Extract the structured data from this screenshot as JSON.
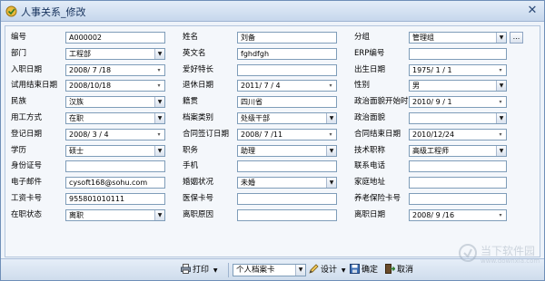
{
  "window": {
    "title": "人事关系_修改",
    "close": "✕"
  },
  "icons": {
    "title": "app-logo-icon",
    "dropdown": "▼",
    "date_picker": "▾",
    "ellipsis": "...",
    "print": "printer-icon",
    "design": "design-icon",
    "confirm": "confirm-icon",
    "cancel": "cancel-icon"
  },
  "fields": {
    "col1": [
      {
        "label": "编号",
        "value": "A000002",
        "type": "text"
      },
      {
        "label": "部门",
        "value": "工程部",
        "type": "combo"
      },
      {
        "label": "入职日期",
        "value": "2008/ 7 /18",
        "type": "date"
      },
      {
        "label": "试用结束日期",
        "value": "2008/10/18",
        "type": "date"
      },
      {
        "label": "民族",
        "value": "汉族",
        "type": "combo"
      },
      {
        "label": "用工方式",
        "value": "在职",
        "type": "combo"
      },
      {
        "label": "登记日期",
        "value": "2008/ 3 / 4",
        "type": "date"
      },
      {
        "label": "学历",
        "value": "硕士",
        "type": "combo"
      },
      {
        "label": "身份证号",
        "value": "",
        "type": "text"
      },
      {
        "label": "电子邮件",
        "value": "cysoft168@sohu.com",
        "type": "text"
      },
      {
        "label": "工资卡号",
        "value": "955801010111",
        "type": "text"
      },
      {
        "label": "在职状态",
        "value": "离职",
        "type": "combo"
      }
    ],
    "col2": [
      {
        "label": "姓名",
        "value": "刘备",
        "type": "text"
      },
      {
        "label": "英文名",
        "value": "fghdfgh",
        "type": "text"
      },
      {
        "label": "爱好特长",
        "value": "",
        "type": "text"
      },
      {
        "label": "退休日期",
        "value": "2011/ 7 / 4",
        "type": "date"
      },
      {
        "label": "籍贯",
        "value": "四川省",
        "type": "text"
      },
      {
        "label": "档案类别",
        "value": "处级干部",
        "type": "combo"
      },
      {
        "label": "合同签订日期",
        "value": "2008/ 7 /11",
        "type": "date"
      },
      {
        "label": "职务",
        "value": "助理",
        "type": "combo"
      },
      {
        "label": "手机",
        "value": "",
        "type": "text"
      },
      {
        "label": "婚姻状况",
        "value": "未婚",
        "type": "combo"
      },
      {
        "label": "医保卡号",
        "value": "",
        "type": "text"
      },
      {
        "label": "离职原因",
        "value": "",
        "type": "text"
      }
    ],
    "col3": [
      {
        "label": "分组",
        "value": "管理组",
        "type": "combo"
      },
      {
        "label": "ERP编号",
        "value": "",
        "type": "text"
      },
      {
        "label": "出生日期",
        "value": "1975/ 1 / 1",
        "type": "date"
      },
      {
        "label": "性别",
        "value": "男",
        "type": "combo"
      },
      {
        "label": "政治面貌开始时",
        "value": "2010/ 9 / 1",
        "type": "date"
      },
      {
        "label": "政治面貌",
        "value": "",
        "type": "combo"
      },
      {
        "label": "合同结束日期",
        "value": "2010/12/24",
        "type": "date"
      },
      {
        "label": "技术职称",
        "value": "高级工程师",
        "type": "combo"
      },
      {
        "label": "联系电话",
        "value": "",
        "type": "text"
      },
      {
        "label": "家庭地址",
        "value": "",
        "type": "text"
      },
      {
        "label": "养老保险卡号",
        "value": "",
        "type": "text"
      },
      {
        "label": "离职日期",
        "value": "2008/ 9 /16",
        "type": "date"
      }
    ]
  },
  "toolbar": {
    "print": "打印",
    "print_dropdown": "▼",
    "template_value": "个人档案卡",
    "design": "设计",
    "confirm": "确定",
    "cancel": "取消"
  },
  "watermark": {
    "text": "当下软件园",
    "sub": "www.downxia.com"
  }
}
